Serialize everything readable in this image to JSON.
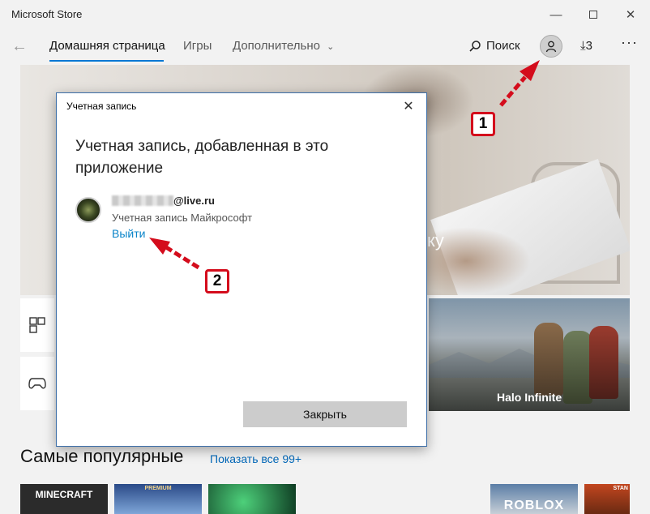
{
  "window": {
    "title": "Microsoft Store",
    "minimize_icon": "minimize-icon",
    "maximize_icon": "maximize-icon",
    "close_icon": "close-icon"
  },
  "nav": {
    "back_icon": "back-arrow-icon",
    "tabs": [
      {
        "label": "Домашняя страница",
        "active": true
      },
      {
        "label": "Игры",
        "active": false
      },
      {
        "label": "Дополнительно",
        "active": false
      }
    ],
    "more_chevron": "chevron-down-icon",
    "search_label": "Поиск",
    "downloads_count": "3",
    "more_label": "···"
  },
  "hero": {
    "text_fragment": "ку"
  },
  "tiles": {
    "halo_label": "Halo Infinite"
  },
  "section": {
    "title": "Самые популярные",
    "show_all": "Показать все 99+",
    "thumbs": [
      {
        "label": "MINECRAFT"
      },
      {
        "label": "PREMIUM"
      },
      {
        "label": ""
      },
      {
        "label": "ROBLOX"
      },
      {
        "label": "STAN"
      }
    ]
  },
  "dialog": {
    "title": "Учетная запись",
    "heading": "Учетная запись, добавленная в это приложение",
    "email_suffix": "@live.ru",
    "account_type": "Учетная запись Майкрософт",
    "logout_label": "Выйти",
    "close_button": "Закрыть"
  },
  "annotations": {
    "badge1": "1",
    "badge2": "2",
    "color": "#d40c1c"
  },
  "colors": {
    "accent": "#0078d4",
    "link": "#0067b8"
  }
}
